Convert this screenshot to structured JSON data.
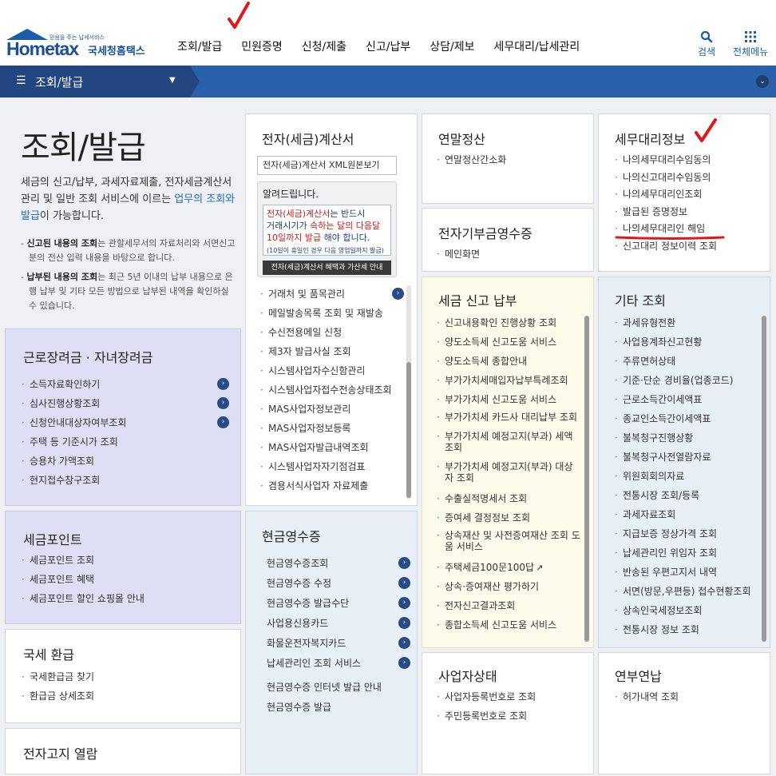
{
  "header": {
    "logo": {
      "slogan": "믿음을 주는 납세서비스",
      "main": "Hometax",
      "sub": "국세청홈택스"
    },
    "gnb": [
      "조회/발급",
      "민원증명",
      "신청/제출",
      "신고/납부",
      "상담/제보",
      "세무대리/납세관리"
    ],
    "search_label": "검색",
    "menu_label": "전체메뉴"
  },
  "navbar": {
    "title": "조회/발급"
  },
  "intro": {
    "title": "조회/발급",
    "desc_part1": "세금의 신고/납부, 과세자료제출, 전자세금계산서 관리 및 일반 조회 서비스에 이르는 ",
    "desc_highlight": "업무의 조회와 발급",
    "desc_part2": "이 가능합니다.",
    "notes": [
      {
        "bold": "신고된 내용의 조회",
        "text": "는 관할세무서의 자료처리와 서면신고분의 전산 입력 내용을 바탕으로 합니다."
      },
      {
        "bold": "납부된 내용의 조회",
        "text": "는 최근 5년 이내의 납부 내용으로 은행 납부 및 기타 모든 방법으로 납부된 내역을 확인하실 수 있습니다."
      }
    ]
  },
  "panels": {
    "labor": {
      "title": "근로장려금 · 자녀장려금",
      "items": [
        "소득자료확인하기",
        "심사진행상황조회",
        "신청안내대상자여부조회",
        "주택 등 기준시가 조회",
        "승용차 가액조회",
        "현지접수창구조회"
      ]
    },
    "taxpoint": {
      "title": "세금포인트",
      "items": [
        "세금포인트 조회",
        "세금포인트 혜택",
        "세금포인트 할인 쇼핑몰 안내"
      ]
    },
    "refund": {
      "title": "국세 환급",
      "items": [
        "국세환급금 찾기",
        "환급금 상세조회"
      ]
    },
    "enotice": {
      "title": "전자고지 열람"
    },
    "einvoice": {
      "title": "전자(세금)계산서",
      "xml_button": "전자(세금)계산서 XML원본보기",
      "notice_title": "알려드립니다.",
      "notice_red": "전자(세금)계산서",
      "notice_line1": "는 반드시",
      "notice_line2a": "거래시기가 ",
      "notice_line2b": "속하는 달의 다음달",
      "notice_line3a": "10일까지 발급",
      "notice_line3b": " 해야 합니다.",
      "notice_small": "(10일이 휴일인 경우 다음 영업일까지 발급)",
      "notice_button": "전자(세금)계산서 혜택과 가산세 안내",
      "items": [
        "거래처 및 품목관리",
        "메일발송목록 조회 및 재발송",
        "수신전용메일 신청",
        "제3자 발급사실 조회",
        "시스템사업자수신함관리",
        "시스템사업자접수전송상태조회",
        "MAS사업자정보관리",
        "MAS사업자정보등록",
        "MAS사업자발급내역조회",
        "시스템사업자자기점검표",
        "겸용서식사업자 자료제출"
      ]
    },
    "cash": {
      "title": "현금영수증",
      "items": [
        "현금영수증조회",
        "현금영수증 수정",
        "현금영수증 발급수단",
        "사업용신용카드",
        "화물운전자복지카드",
        "납세관리인 조회 서비스",
        "현금영수증 인터넷 발급 안내",
        "현금영수증 발급"
      ]
    },
    "yearend": {
      "title": "연말정산",
      "items": [
        "연말정산간소화"
      ]
    },
    "donation": {
      "title": "전자기부금영수증",
      "items": [
        "메인화면"
      ]
    },
    "taxpay": {
      "title": "세금 신고 납부",
      "items": [
        "신고내용확인 진행상황 조회",
        "양도소득세 신고도움 서비스",
        "양도소득세 종합안내",
        "부가가치세매입자납부특례조회",
        "부가가치세 신고도움 서비스",
        "부가가치세 카드사 대리납부 조회",
        "부가가치세 예정고지(부과) 세액조회",
        "부가가치세 예정고지(부과) 대상자 조회",
        "수출실적명세서 조회",
        "증여세 결정정보 조회",
        "상속재산 및 사전증여재산 조회 도움 서비스",
        "주택세금100문100답",
        "상속·증여재산 평가하기",
        "전자신고결과조회",
        "종합소득세 신고도움 서비스"
      ]
    },
    "bizstatus": {
      "title": "사업자상태",
      "items": [
        "사업자등록번호로 조회",
        "주민등록번호로 조회"
      ]
    },
    "agent": {
      "title": "세무대리정보",
      "items": [
        "나의세무대리수임동의",
        "나의신고대리수임동의",
        "나의세무대리인조회",
        "발급된 증명정보",
        "나의세무대리인 해임",
        "신고대리 정보이력 조회"
      ]
    },
    "etc": {
      "title": "기타 조회",
      "items": [
        "과세유형전환",
        "사업용계좌신고현황",
        "주류면허상태",
        "기준·단순 경비율(업종코드)",
        "근로소득간이세액표",
        "종교인소득간이세액표",
        "불복청구진행상황",
        "불복청구사전열람자료",
        "위원회회의자료",
        "전통시장 조회/등록",
        "과세자료조회",
        "지급보증 정상가격 조회",
        "납세관리인 위임자 조회",
        "반송된 우편고지서 내역",
        "서면(방문,우편등) 접수현황조회",
        "상속인국세정보조회",
        "전통시장 정보 조회"
      ]
    },
    "extension": {
      "title": "연부연납",
      "items": [
        "허가내역 조회"
      ]
    }
  }
}
